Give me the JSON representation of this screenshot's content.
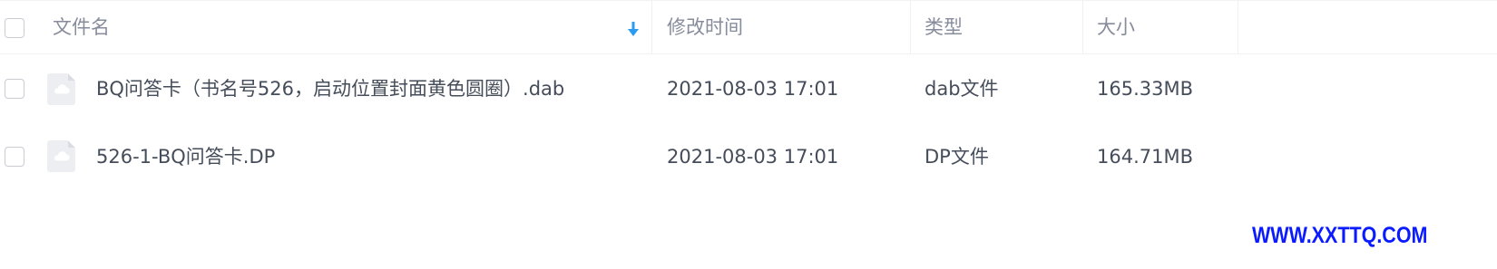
{
  "columns": {
    "name": "文件名",
    "modified": "修改时间",
    "type": "类型",
    "size": "大小"
  },
  "sort": {
    "column": "name",
    "direction": "descending",
    "icon": "arrow-down-icon"
  },
  "files": [
    {
      "name": "BQ问答卡（书名号526，启动位置封面黄色圆圈）.dab",
      "modified": "2021-08-03 17:01",
      "type": "dab文件",
      "size": "165.33MB",
      "icon": "cloud-file-icon"
    },
    {
      "name": "526-1-BQ问答卡.DP",
      "modified": "2021-08-03 17:01",
      "type": "DP文件",
      "size": "164.71MB",
      "icon": "cloud-file-icon"
    }
  ],
  "watermark": "WWW.XXTTQ.COM",
  "colors": {
    "header_text": "#878c9c",
    "body_text": "#454d5a",
    "sort_arrow": "#2b9cf0",
    "watermark": "#0b1bff"
  }
}
